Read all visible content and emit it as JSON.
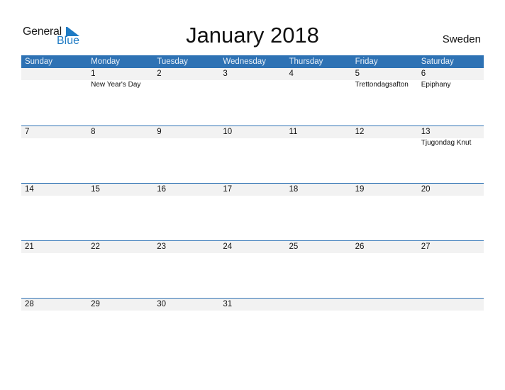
{
  "logo": {
    "line1": "General",
    "line2": "Blue"
  },
  "title": "January 2018",
  "country": "Sweden",
  "colors": {
    "accent": "#2e72b4",
    "strip": "#f2f2f2",
    "logo_blue": "#1f7bc4"
  },
  "weekdays": [
    "Sunday",
    "Monday",
    "Tuesday",
    "Wednesday",
    "Thursday",
    "Friday",
    "Saturday"
  ],
  "weeks": [
    [
      {
        "num": "",
        "hol": ""
      },
      {
        "num": "1",
        "hol": "New Year's Day"
      },
      {
        "num": "2",
        "hol": ""
      },
      {
        "num": "3",
        "hol": ""
      },
      {
        "num": "4",
        "hol": ""
      },
      {
        "num": "5",
        "hol": "Trettondagsafton"
      },
      {
        "num": "6",
        "hol": "Epiphany"
      }
    ],
    [
      {
        "num": "7",
        "hol": ""
      },
      {
        "num": "8",
        "hol": ""
      },
      {
        "num": "9",
        "hol": ""
      },
      {
        "num": "10",
        "hol": ""
      },
      {
        "num": "11",
        "hol": ""
      },
      {
        "num": "12",
        "hol": ""
      },
      {
        "num": "13",
        "hol": "Tjugondag Knut"
      }
    ],
    [
      {
        "num": "14",
        "hol": ""
      },
      {
        "num": "15",
        "hol": ""
      },
      {
        "num": "16",
        "hol": ""
      },
      {
        "num": "17",
        "hol": ""
      },
      {
        "num": "18",
        "hol": ""
      },
      {
        "num": "19",
        "hol": ""
      },
      {
        "num": "20",
        "hol": ""
      }
    ],
    [
      {
        "num": "21",
        "hol": ""
      },
      {
        "num": "22",
        "hol": ""
      },
      {
        "num": "23",
        "hol": ""
      },
      {
        "num": "24",
        "hol": ""
      },
      {
        "num": "25",
        "hol": ""
      },
      {
        "num": "26",
        "hol": ""
      },
      {
        "num": "27",
        "hol": ""
      }
    ],
    [
      {
        "num": "28",
        "hol": ""
      },
      {
        "num": "29",
        "hol": ""
      },
      {
        "num": "30",
        "hol": ""
      },
      {
        "num": "31",
        "hol": ""
      },
      {
        "num": "",
        "hol": ""
      },
      {
        "num": "",
        "hol": ""
      },
      {
        "num": "",
        "hol": ""
      }
    ]
  ]
}
